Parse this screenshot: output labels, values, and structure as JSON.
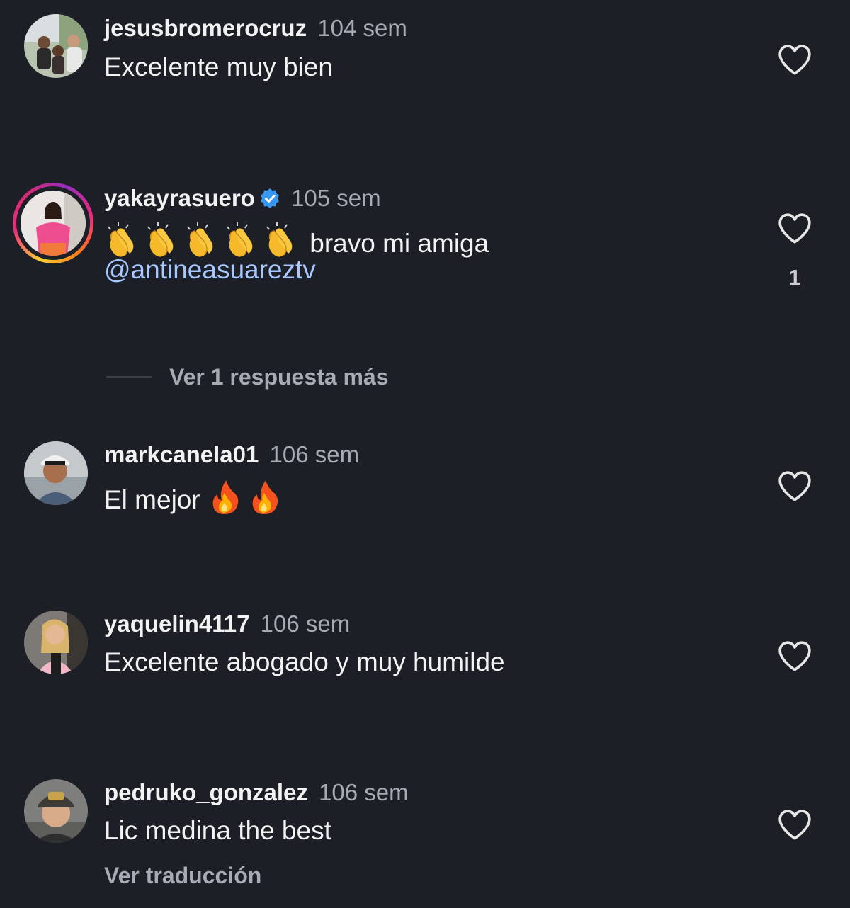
{
  "comments": [
    {
      "username": "jesusbromerocruz",
      "time": "104 sem",
      "text": "Excelente muy bien",
      "likes": ""
    },
    {
      "username": "yakayrasuero",
      "verified": true,
      "time": "105 sem",
      "text": "bravo mi amiga",
      "mention": "@antineasuareztv",
      "likes": "1",
      "view_replies": "Ver 1 respuesta más"
    },
    {
      "username": "markcanela01",
      "time": "106 sem",
      "text": "El mejor",
      "likes": ""
    },
    {
      "username": "yaquelin4117",
      "time": "106 sem",
      "text": "Excelente abogado y muy humilde",
      "likes": ""
    },
    {
      "username": "pedruko_gonzalez",
      "time": "106 sem",
      "text": "Lic medina the best",
      "likes": "",
      "translate": "Ver traducción"
    }
  ],
  "icons": {
    "like": "heart-outline-icon",
    "verified": "verified-badge-icon",
    "clap_emoji": "clapping-hands-emoji",
    "fire_emoji": "fire-emoji"
  },
  "colors": {
    "background": "#1c1f26",
    "mention": "#a9c7ff",
    "verified": "#3897f0"
  }
}
